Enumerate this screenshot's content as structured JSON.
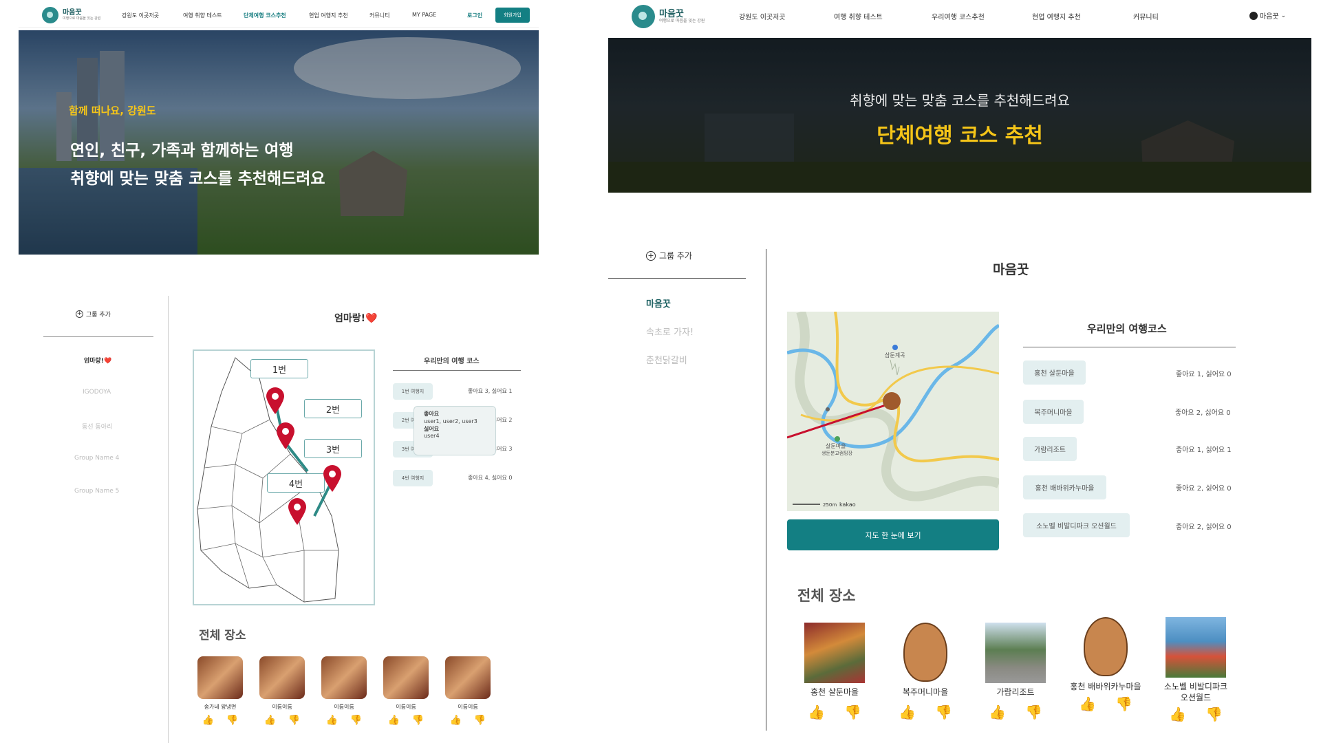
{
  "left": {
    "logo": {
      "title": "마음꿋",
      "sub": "여행으로 마음을 잇는 강원"
    },
    "nav": [
      "강원도 이곳저곳",
      "여행 취향 테스트",
      "단체여행 코스추천",
      "현업 여행지 추천",
      "커뮤니티",
      "MY PAGE"
    ],
    "login_label": "로그인",
    "signup_label": "회원가입",
    "hero": {
      "kicker": "함께 떠나요, 강원도",
      "line1": "연인, 친구, 가족과 함께하는 여행",
      "line2": "취향에 맞는 맞춤 코스를 추천해드려요"
    },
    "add_group": "그룹 추가",
    "groups": [
      "엄마랑!❤️",
      "IGODOYA",
      "동선 동아리",
      "Group Name 4",
      "Group Name 5"
    ],
    "group_title": "엄마랑!❤️",
    "map_labels": [
      "1번",
      "2번",
      "3번",
      "4번"
    ],
    "course_title": "우리만의 여행 코스",
    "courses": [
      {
        "name": "1번 여행지",
        "stats": "좋아요 3, 싫어요 1"
      },
      {
        "name": "2번 여행지",
        "stats": "좋아요 4, 싫어요 2"
      },
      {
        "name": "3번 여행지",
        "stats": "좋아요 4, 싫어요 3"
      },
      {
        "name": "4번 여행지",
        "stats": "좋아요 4, 싫어요 0"
      }
    ],
    "tooltip": {
      "like_label": "좋아요",
      "like_users": "user1, user2, user3",
      "dislike_label": "싫어요",
      "dislike_users": "user4"
    },
    "all_places_title": "전체 장소",
    "places": [
      "송가네 왕냉면",
      "이름이름",
      "이름이름",
      "이름이름",
      "이름이름"
    ]
  },
  "right": {
    "logo": {
      "title": "마음꿋",
      "sub": "여행으로 마음을 잇는 강원"
    },
    "nav": [
      "강원도 이곳저곳",
      "여행 취향 테스트",
      "우리여행 코스추천",
      "현업 여행지 추천",
      "커뮤니티"
    ],
    "user_label": "마음꿋",
    "hero": {
      "line1": "취향에 맞는 맞춤 코스를 추천해드려요",
      "line2": "단체여행 코스 추천"
    },
    "add_group": "그룹 추가",
    "groups": [
      "마음꿋",
      "속초로 가자!",
      "춘천닭갈비"
    ],
    "group_title": "마음꿋",
    "map_pois": [
      "삼둔계곡",
      "살둔마을",
      "생둔분교캠핑장"
    ],
    "map_scale": "250m",
    "map_brand": "kakao",
    "view_map_button": "지도 한 눈에 보기",
    "course_title": "우리만의 여행코스",
    "courses": [
      {
        "name": "홍천 살둔마을",
        "stats": "좋아요 1, 싫어요 0"
      },
      {
        "name": "복주머니마을",
        "stats": "좋아요 2, 싫어요 0"
      },
      {
        "name": "가람리조트",
        "stats": "좋아요 1, 싫어요 1"
      },
      {
        "name": "홍천 배바위카누마을",
        "stats": "좋아요 2, 싫어요 0"
      },
      {
        "name": "소노벨 비발디파크 오션월드",
        "stats": "좋아요 2, 싫어요 0"
      }
    ],
    "all_places_title": "전체 장소",
    "places": [
      "홍천 살둔마을",
      "복주머니마을",
      "가람리조트",
      "홍천 배바위카누마을",
      "소노벨 비발디파크 오션월드"
    ]
  },
  "colors": {
    "teal": "#137f83",
    "accent_yellow": "#f5c518",
    "pin_red": "#c8102e"
  }
}
